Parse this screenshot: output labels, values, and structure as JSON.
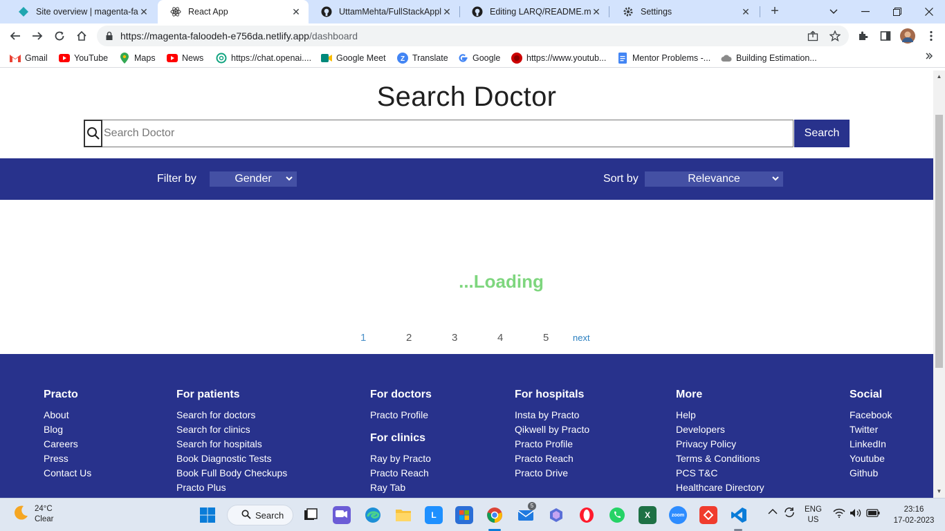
{
  "browser": {
    "tabs": [
      {
        "title": "Site overview | magenta-faloo",
        "icon": "netlify-icon"
      },
      {
        "title": "React App",
        "icon": "react-icon"
      },
      {
        "title": "UttamMehta/FullStackApplic",
        "icon": "github-icon"
      },
      {
        "title": "Editing LARQ/README.md at",
        "icon": "github-icon"
      },
      {
        "title": "Settings",
        "icon": "gear-icon"
      }
    ],
    "url_host": "https://magenta-faloodeh-e756da.netlify.app",
    "url_path": "/dashboard",
    "bookmarks": [
      {
        "label": "Gmail",
        "icon": "gmail-icon",
        "color": "#ea4335"
      },
      {
        "label": "YouTube",
        "icon": "youtube-icon",
        "color": "#ff0000"
      },
      {
        "label": "Maps",
        "icon": "maps-icon",
        "color": "#34a853"
      },
      {
        "label": "News",
        "icon": "youtube-icon",
        "color": "#ff0000"
      },
      {
        "label": "https://chat.openai....",
        "icon": "openai-icon",
        "color": "#10a37f"
      },
      {
        "label": "Google Meet",
        "icon": "meet-icon",
        "color": "#00897b"
      },
      {
        "label": "Translate",
        "icon": "translate-icon",
        "color": "#4285f4"
      },
      {
        "label": "Google",
        "icon": "google-icon",
        "color": "#4285f4"
      },
      {
        "label": "https://www.youtub...",
        "icon": "record-icon",
        "color": "#cc0000"
      },
      {
        "label": "Mentor Problems -...",
        "icon": "docs-icon",
        "color": "#4285f4"
      },
      {
        "label": "Building Estimation...",
        "icon": "cloud-icon",
        "color": "#777777"
      }
    ]
  },
  "page": {
    "title": "Search Doctor",
    "search_placeholder": "Search Doctor",
    "search_button": "Search",
    "filter_label": "Filter by",
    "filter_value": "Gender",
    "sort_label": "Sort by",
    "sort_value": "Relevance",
    "loading_text": "...Loading",
    "pagination": {
      "pages": [
        "1",
        "2",
        "3",
        "4",
        "5"
      ],
      "current": "1",
      "next_label": "next"
    },
    "colors": {
      "brand": "#28328c",
      "loading": "#7ed67e",
      "select": "#4450a4"
    }
  },
  "footer": {
    "columns": [
      {
        "heading": "Practo",
        "links": [
          "About",
          "Blog",
          "Careers",
          "Press",
          "Contact Us"
        ]
      },
      {
        "heading": "For patients",
        "links": [
          "Search for doctors",
          "Search for clinics",
          "Search for hospitals",
          "Book Diagnostic Tests",
          "Book Full Body Checkups",
          "Practo Plus"
        ]
      },
      {
        "heading": "For doctors",
        "links": [
          "Practo Profile"
        ],
        "subheading": "For clinics",
        "sublinks": [
          "Ray by Practo",
          "Practo Reach",
          "Ray Tab"
        ]
      },
      {
        "heading": "For hospitals",
        "links": [
          "Insta by Practo",
          "Qikwell by Practo",
          "Practo Profile",
          "Practo Reach",
          "Practo Drive"
        ]
      },
      {
        "heading": "More",
        "links": [
          "Help",
          "Developers",
          "Privacy Policy",
          "Terms & Conditions",
          "PCS T&C",
          "Healthcare Directory"
        ]
      },
      {
        "heading": "Social",
        "links": [
          "Facebook",
          "Twitter",
          "LinkedIn",
          "Youtube",
          "Github"
        ]
      }
    ]
  },
  "taskbar": {
    "weather_temp": "24°C",
    "weather_desc": "Clear",
    "search_label": "Search",
    "mail_badge": "5",
    "lang_top": "ENG",
    "lang_bottom": "US",
    "time": "23:16",
    "date": "17-02-2023"
  }
}
